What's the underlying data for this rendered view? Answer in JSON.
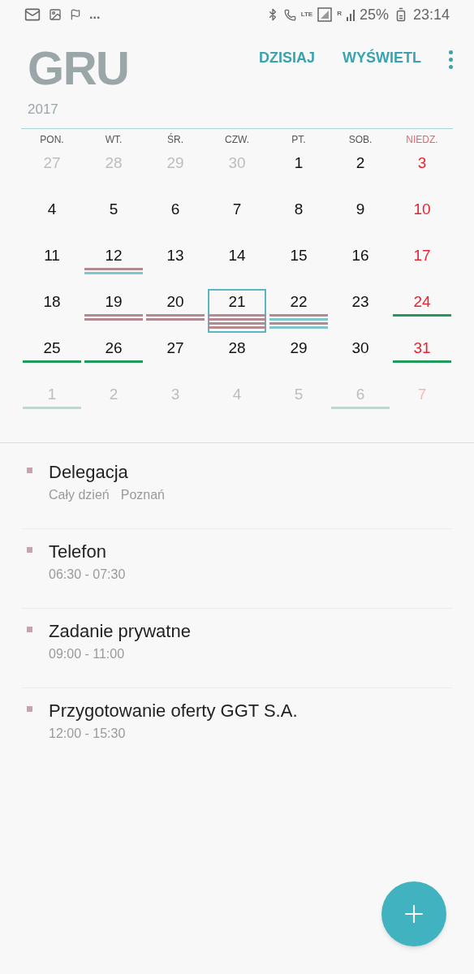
{
  "status_bar": {
    "more": "...",
    "lte": "LTE",
    "roaming": "R",
    "battery": "25%",
    "time": "23:14"
  },
  "header": {
    "month": "GRU",
    "year": "2017",
    "actions": [
      "DZISIAJ",
      "WYŚWIETL"
    ]
  },
  "weekdays": [
    "PON.",
    "WT.",
    "ŚR.",
    "CZW.",
    "PT.",
    "SOB.",
    "NIEDZ."
  ],
  "weeks": [
    [
      {
        "day": "27",
        "kind": "out",
        "selected": false
      },
      {
        "day": "28",
        "kind": "out",
        "selected": false
      },
      {
        "day": "29",
        "kind": "out",
        "selected": false
      },
      {
        "day": "30",
        "kind": "out",
        "selected": false
      },
      {
        "day": "1",
        "kind": "in",
        "selected": false
      },
      {
        "day": "2",
        "kind": "in",
        "selected": false
      },
      {
        "day": "3",
        "kind": "in",
        "selected": false
      }
    ],
    [
      {
        "day": "4",
        "kind": "in",
        "selected": false
      },
      {
        "day": "5",
        "kind": "in",
        "selected": false
      },
      {
        "day": "6",
        "kind": "in",
        "selected": false
      },
      {
        "day": "7",
        "kind": "in",
        "selected": false
      },
      {
        "day": "8",
        "kind": "in",
        "selected": false
      },
      {
        "day": "9",
        "kind": "in",
        "selected": false
      },
      {
        "day": "10",
        "kind": "in",
        "selected": false
      }
    ],
    [
      {
        "day": "11",
        "kind": "in",
        "selected": false
      },
      {
        "day": "12",
        "kind": "in",
        "selected": false,
        "events": [
          {
            "color": "#b48a92"
          },
          {
            "color": "#7cc6cc"
          }
        ]
      },
      {
        "day": "13",
        "kind": "in",
        "selected": false
      },
      {
        "day": "14",
        "kind": "in",
        "selected": false
      },
      {
        "day": "15",
        "kind": "in",
        "selected": false
      },
      {
        "day": "16",
        "kind": "in",
        "selected": false
      },
      {
        "day": "17",
        "kind": "in",
        "selected": false
      }
    ],
    [
      {
        "day": "18",
        "kind": "in",
        "selected": false
      },
      {
        "day": "19",
        "kind": "in",
        "selected": false,
        "events": [
          {
            "color": "#b48a92"
          },
          {
            "color": "#b48a92"
          }
        ]
      },
      {
        "day": "20",
        "kind": "in",
        "selected": false,
        "events": [
          {
            "color": "#b48a92"
          },
          {
            "color": "#b48a92"
          }
        ]
      },
      {
        "day": "21",
        "kind": "in",
        "selected": true,
        "events": [
          {
            "color": "#b48a92"
          },
          {
            "color": "#b48a92"
          },
          {
            "color": "#b48a92"
          },
          {
            "color": "#b48a92"
          }
        ]
      },
      {
        "day": "22",
        "kind": "in",
        "selected": false,
        "events": [
          {
            "color": "#b48a92"
          },
          {
            "color": "#7cc6cc"
          },
          {
            "color": "#b48a92"
          },
          {
            "color": "#7cc6cc"
          }
        ]
      },
      {
        "day": "23",
        "kind": "in",
        "selected": false
      },
      {
        "day": "24",
        "kind": "in",
        "selected": false,
        "events": [
          {
            "color": "#1f9a5a"
          }
        ]
      }
    ],
    [
      {
        "day": "25",
        "kind": "in",
        "selected": false,
        "events": [
          {
            "color": "#1f9a5a"
          }
        ]
      },
      {
        "day": "26",
        "kind": "in",
        "selected": false,
        "events": [
          {
            "color": "#1f9a5a"
          }
        ]
      },
      {
        "day": "27",
        "kind": "in",
        "selected": false
      },
      {
        "day": "28",
        "kind": "in",
        "selected": false
      },
      {
        "day": "29",
        "kind": "in",
        "selected": false
      },
      {
        "day": "30",
        "kind": "in",
        "selected": false
      },
      {
        "day": "31",
        "kind": "in",
        "selected": false,
        "events": [
          {
            "color": "#1f9a5a"
          }
        ]
      }
    ],
    [
      {
        "day": "1",
        "kind": "out",
        "selected": false,
        "events": [
          {
            "color": "#b9dcc8"
          }
        ]
      },
      {
        "day": "2",
        "kind": "out",
        "selected": false
      },
      {
        "day": "3",
        "kind": "out",
        "selected": false
      },
      {
        "day": "4",
        "kind": "out",
        "selected": false
      },
      {
        "day": "5",
        "kind": "out",
        "selected": false
      },
      {
        "day": "6",
        "kind": "out",
        "selected": false,
        "events": [
          {
            "color": "#b9dcc8"
          }
        ]
      },
      {
        "day": "7",
        "kind": "out",
        "selected": false
      }
    ]
  ],
  "events": [
    {
      "title": "Delegacja",
      "details": [
        "Cały dzień",
        "Poznań"
      ],
      "color": "#c9a3ab"
    },
    {
      "title": "Telefon",
      "details": [
        "06:30 - 07:30"
      ],
      "color": "#c9a3ab"
    },
    {
      "title": "Zadanie prywatne",
      "details": [
        "09:00 - 11:00"
      ],
      "color": "#c9a3ab"
    },
    {
      "title": "Przygotowanie oferty GGT S.A.",
      "details": [
        "12:00 - 15:30"
      ],
      "color": "#c9a3ab"
    }
  ]
}
